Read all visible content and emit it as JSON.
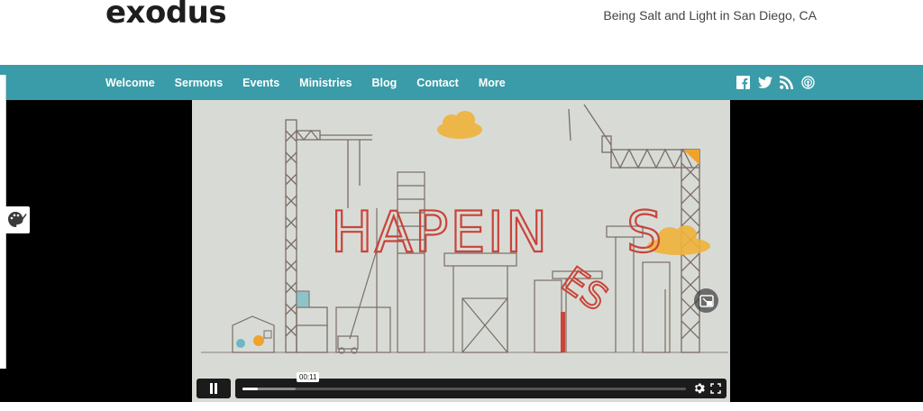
{
  "header": {
    "logo": "exodus",
    "tagline": "Being Salt and Light in San Diego, CA"
  },
  "nav": {
    "items": [
      {
        "label": "Welcome"
      },
      {
        "label": "Sermons"
      },
      {
        "label": "Events"
      },
      {
        "label": "Ministries"
      },
      {
        "label": "Blog"
      },
      {
        "label": "Contact"
      },
      {
        "label": "More"
      }
    ],
    "social_icons": [
      "facebook-icon",
      "twitter-icon",
      "rss-icon",
      "podcast-icon"
    ]
  },
  "video": {
    "artwork_text": "HAPEIN",
    "artwork_text2": "S",
    "artwork_text3": "ES",
    "current_time": "00:11",
    "progress_fraction": 0.034,
    "buffered_fraction": 0.12
  },
  "colors": {
    "nav_bg": "#3a9ca8",
    "letters": "#c9443a",
    "cloud": "#f0b23a"
  }
}
